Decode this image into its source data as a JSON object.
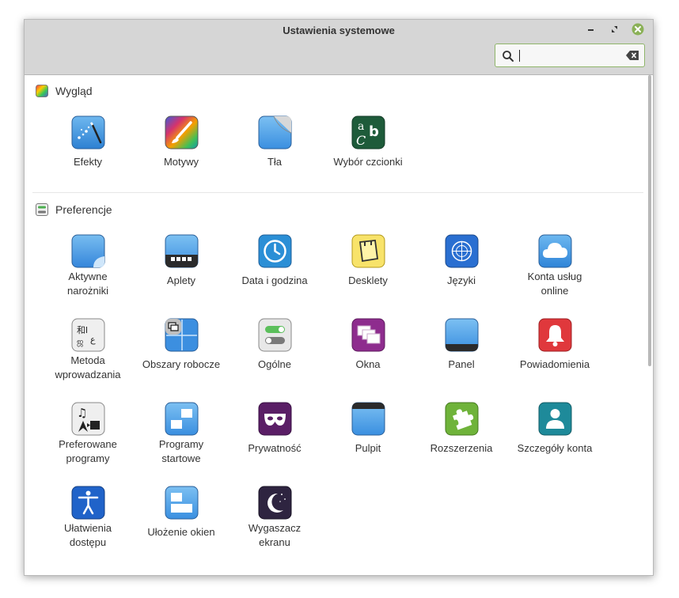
{
  "window": {
    "title": "Ustawienia systemowe"
  },
  "search": {
    "value": "",
    "placeholder": ""
  },
  "sections": {
    "appearance": {
      "title": "Wygląd",
      "items": [
        {
          "label": "Efekty",
          "icon": "effects-icon"
        },
        {
          "label": "Motywy",
          "icon": "themes-icon"
        },
        {
          "label": "Tła",
          "icon": "backgrounds-icon"
        },
        {
          "label": "Wybór czcionki",
          "icon": "font-selection-icon"
        }
      ]
    },
    "preferences": {
      "title": "Preferencje",
      "items": [
        {
          "label": "Aktywne\nnarożniki",
          "icon": "hot-corners-icon"
        },
        {
          "label": "Aplety",
          "icon": "applets-icon"
        },
        {
          "label": "Data i godzina",
          "icon": "clock-icon"
        },
        {
          "label": "Desklety",
          "icon": "desklets-icon"
        },
        {
          "label": "Języki",
          "icon": "languages-icon"
        },
        {
          "label": "Konta usług\nonline",
          "icon": "online-accounts-icon"
        },
        {
          "label": "Metoda\nwprowadzania",
          "icon": "input-method-icon"
        },
        {
          "label": "Obszary robocze",
          "icon": "workspaces-icon"
        },
        {
          "label": "Ogólne",
          "icon": "general-icon"
        },
        {
          "label": "Okna",
          "icon": "windows-icon"
        },
        {
          "label": "Panel",
          "icon": "panel-icon"
        },
        {
          "label": "Powiadomienia",
          "icon": "notifications-icon"
        },
        {
          "label": "Preferowane\nprogramy",
          "icon": "preferred-applications-icon"
        },
        {
          "label": "Programy\nstartowe",
          "icon": "startup-applications-icon"
        },
        {
          "label": "Prywatność",
          "icon": "privacy-icon"
        },
        {
          "label": "Pulpit",
          "icon": "desktop-icon"
        },
        {
          "label": "Rozszerzenia",
          "icon": "extensions-icon"
        },
        {
          "label": "Szczegóły konta",
          "icon": "account-details-icon"
        },
        {
          "label": "Ułatwienia\ndostępu",
          "icon": "accessibility-icon"
        },
        {
          "label": "Ułożenie okien",
          "icon": "window-tiling-icon"
        },
        {
          "label": "Wygaszacz\nekranu",
          "icon": "screensaver-icon"
        }
      ]
    }
  },
  "colors": {
    "header_bg": "#d6d6d6",
    "search_border": "#8fb56a",
    "close_button": "#8bb158",
    "text": "#333333"
  }
}
